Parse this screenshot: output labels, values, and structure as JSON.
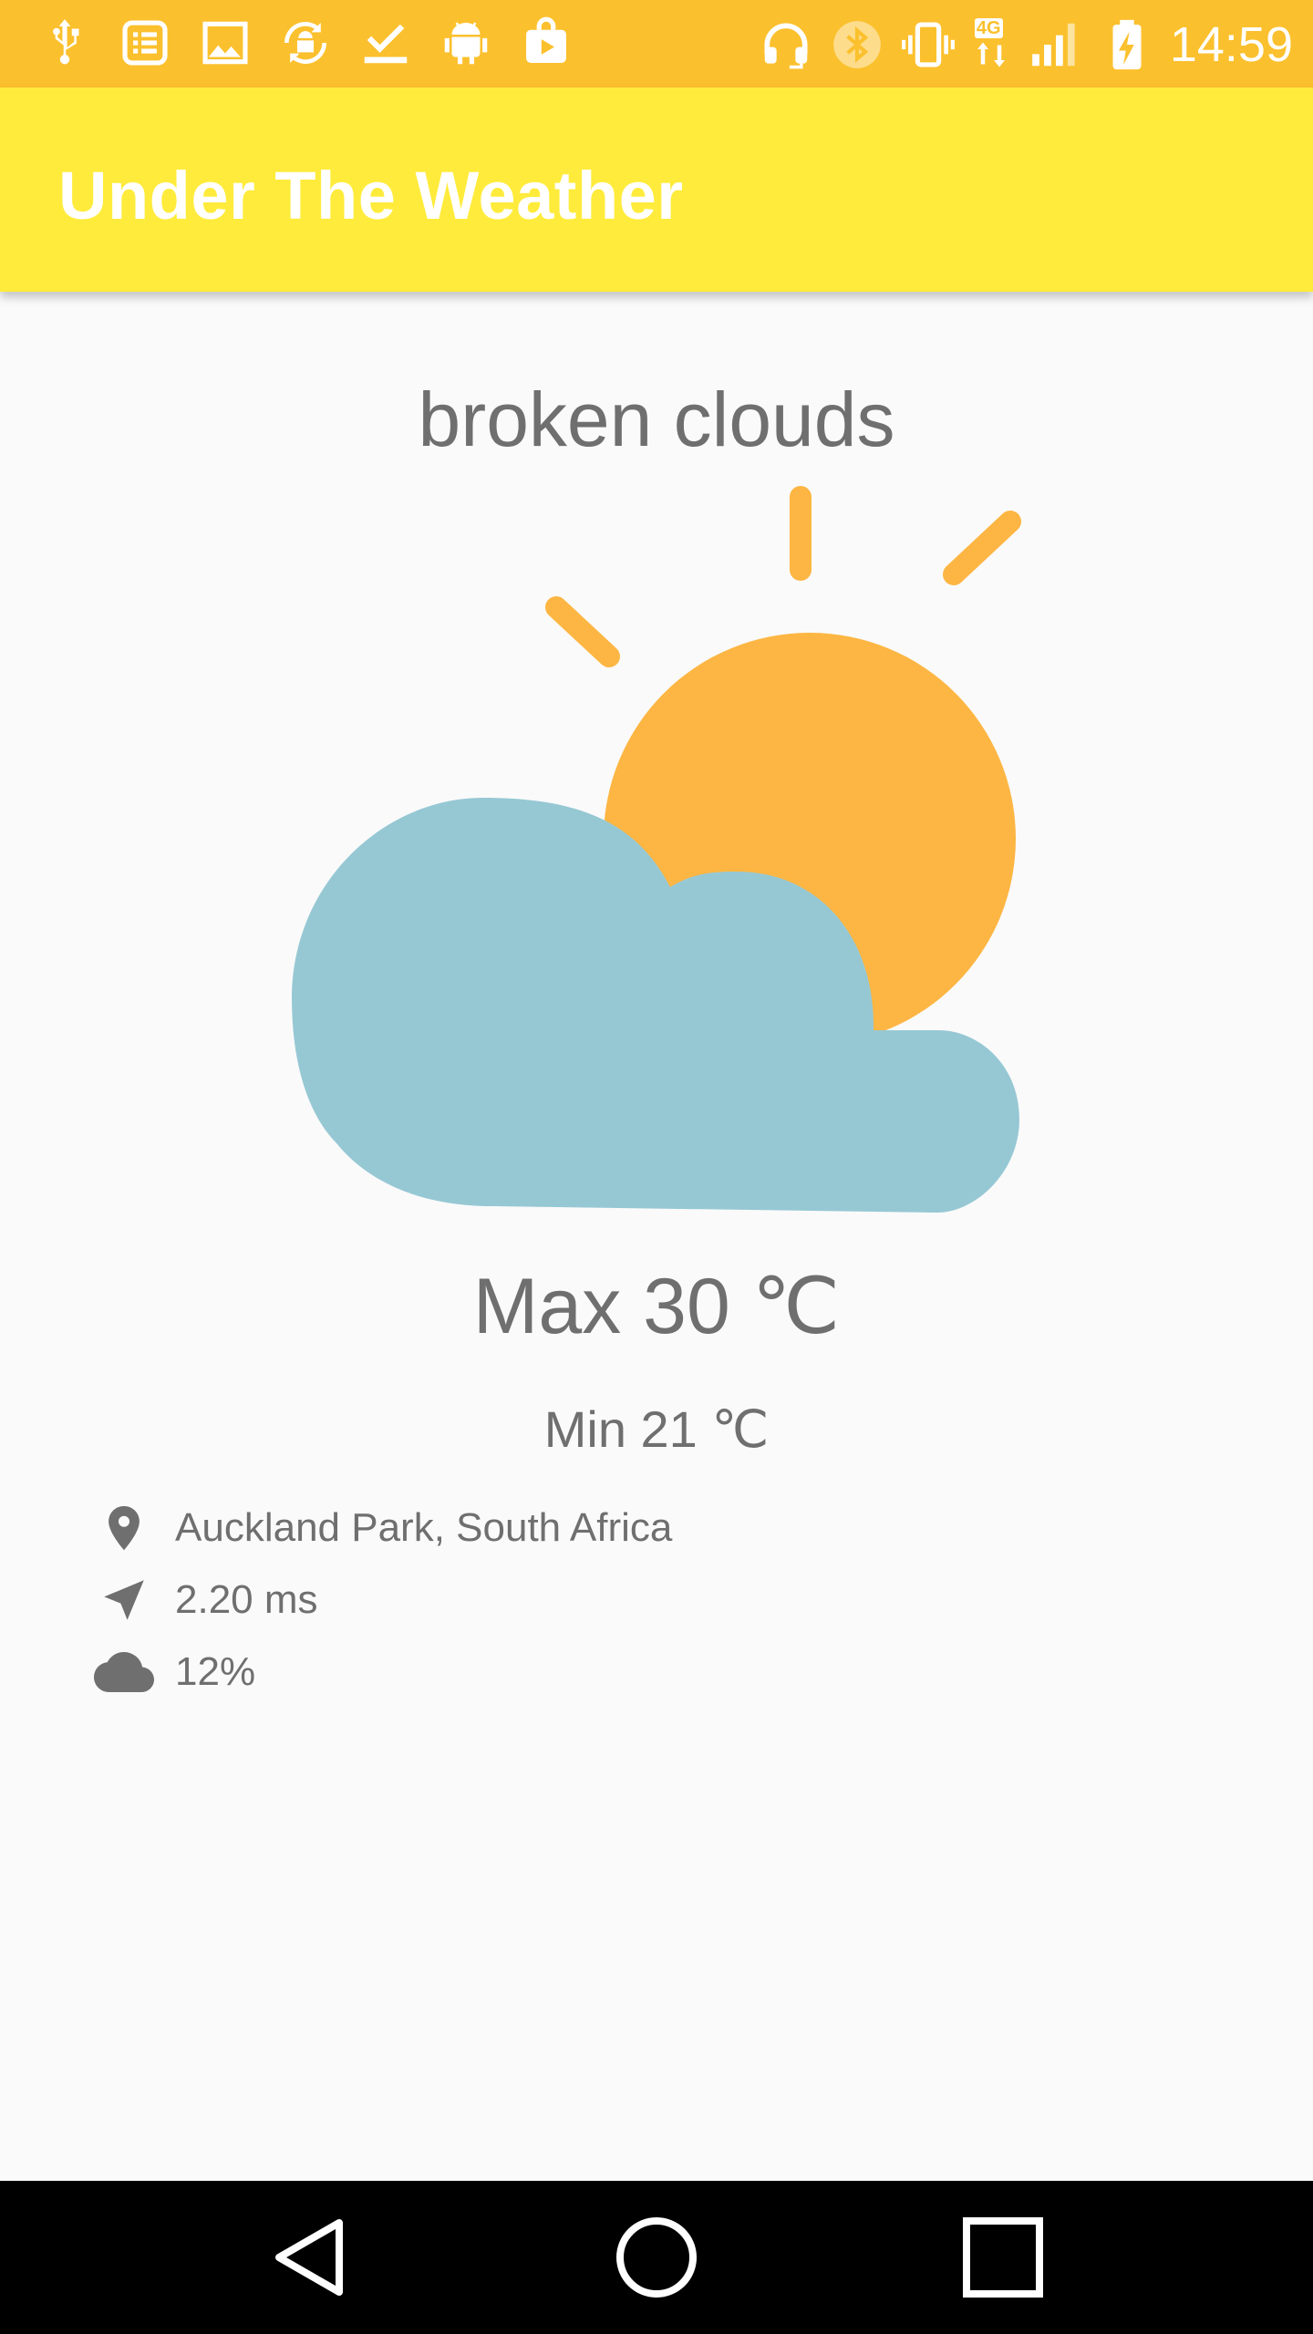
{
  "status_bar": {
    "time": "14:59",
    "left_icons": [
      "usb-icon",
      "list-icon",
      "image-icon",
      "sync-android-icon",
      "download-done-icon",
      "android-icon",
      "play-bag-icon"
    ],
    "right_icons": [
      "headset-icon",
      "bluetooth-icon",
      "vibrate-icon",
      "network-4g-icon",
      "signal-icon",
      "battery-charging-icon"
    ],
    "network_label": "4G",
    "color": "#fbc02d"
  },
  "app_bar": {
    "title": "Under The Weather",
    "color": "#ffeb3b"
  },
  "weather": {
    "description": "broken clouds",
    "icon": "sun-behind-cloud-icon",
    "max": "Max 30 ℃",
    "min": "Min 21 ℃",
    "sun_color": "#fdb643",
    "cloud_color": "#96c8d4"
  },
  "details": [
    {
      "icon": "location-pin-icon",
      "text": "Auckland Park, South Africa"
    },
    {
      "icon": "navigation-arrow-icon",
      "text": "2.20 ms"
    },
    {
      "icon": "cloud-icon",
      "text": "12%"
    }
  ],
  "nav_bar": {
    "buttons": [
      "back-button",
      "home-button",
      "recents-button"
    ]
  }
}
